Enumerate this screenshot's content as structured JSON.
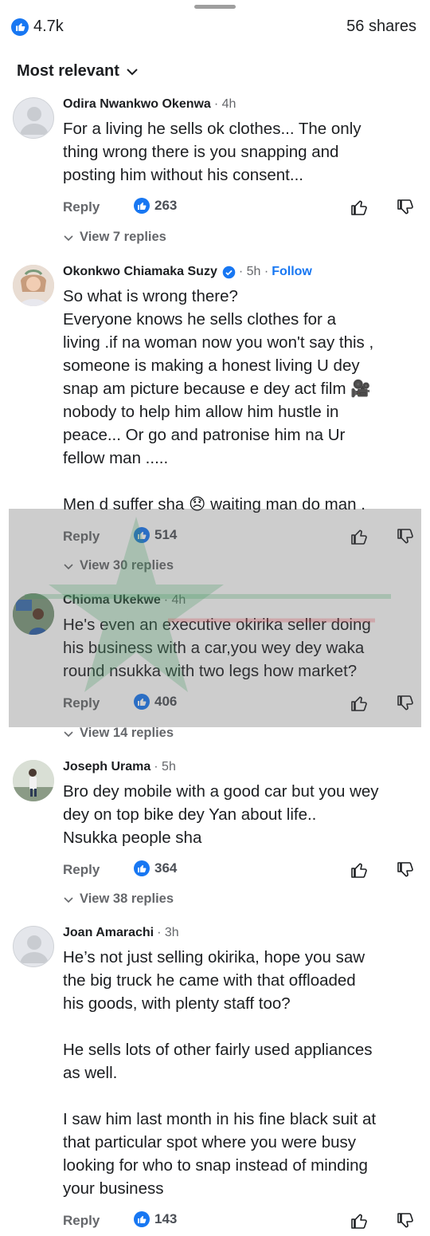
{
  "header": {
    "likes_count": "4.7k",
    "shares_label": "56 shares",
    "sort_label": "Most relevant"
  },
  "comments": [
    {
      "name": "Odira Nwankwo Okenwa",
      "time": "4h",
      "text": [
        "For a living he sells ok clothes... The only",
        "thing wrong there is you snapping and",
        "posting him without his consent..."
      ],
      "reply_label": "Reply",
      "reactions": "263",
      "view_replies": "View 7 replies"
    },
    {
      "name": "Okonkwo Chiamaka Suzy",
      "verified": true,
      "time": "5h",
      "follow_label": "Follow",
      "text": [
        "So what is wrong there?",
        "Everyone knows he sells clothes for a",
        "living .if na woman now you won't say this ,",
        "someone is making a honest living U dey",
        "snap am picture because e dey act film 🎥",
        "nobody to help him allow him hustle in",
        "peace... Or go and patronise him na Ur",
        "fellow man .....",
        "",
        "Men d suffer sha 😞 waiting man do man ."
      ],
      "reply_label": "Reply",
      "reactions": "514",
      "view_replies": "View 30 replies"
    },
    {
      "name": "Chioma Ukekwe",
      "time": "4h",
      "text": [
        "He's even an executive okirika seller doing",
        "his business with a car,you wey dey waka",
        "round nsukka with two legs how market?"
      ],
      "reply_label": "Reply",
      "reactions": "406",
      "view_replies": "View 14 replies"
    },
    {
      "name": "Joseph Urama",
      "time": "5h",
      "text": [
        "Bro dey mobile with a good car but you wey",
        "dey on top bike dey Yan about life..",
        "Nsukka people sha"
      ],
      "reply_label": "Reply",
      "reactions": "364",
      "view_replies": "View 38 replies"
    },
    {
      "name": "Joan Amarachi",
      "time": "3h",
      "text": [
        "He’s not just selling okirika, hope you saw",
        "the big truck he came with that offloaded",
        "his goods, with plenty staff too?",
        "",
        "He sells lots of other fairly used appliances",
        "as well.",
        "",
        "I saw him last month in his fine black suit at",
        "that particular spot where you were busy",
        "looking for who to snap instead of minding",
        "your business"
      ],
      "reply_label": "Reply",
      "reactions": "143"
    }
  ],
  "colors": {
    "accent": "#1877f2",
    "secondary_text": "#65676b",
    "primary_text": "#1c1e21"
  }
}
